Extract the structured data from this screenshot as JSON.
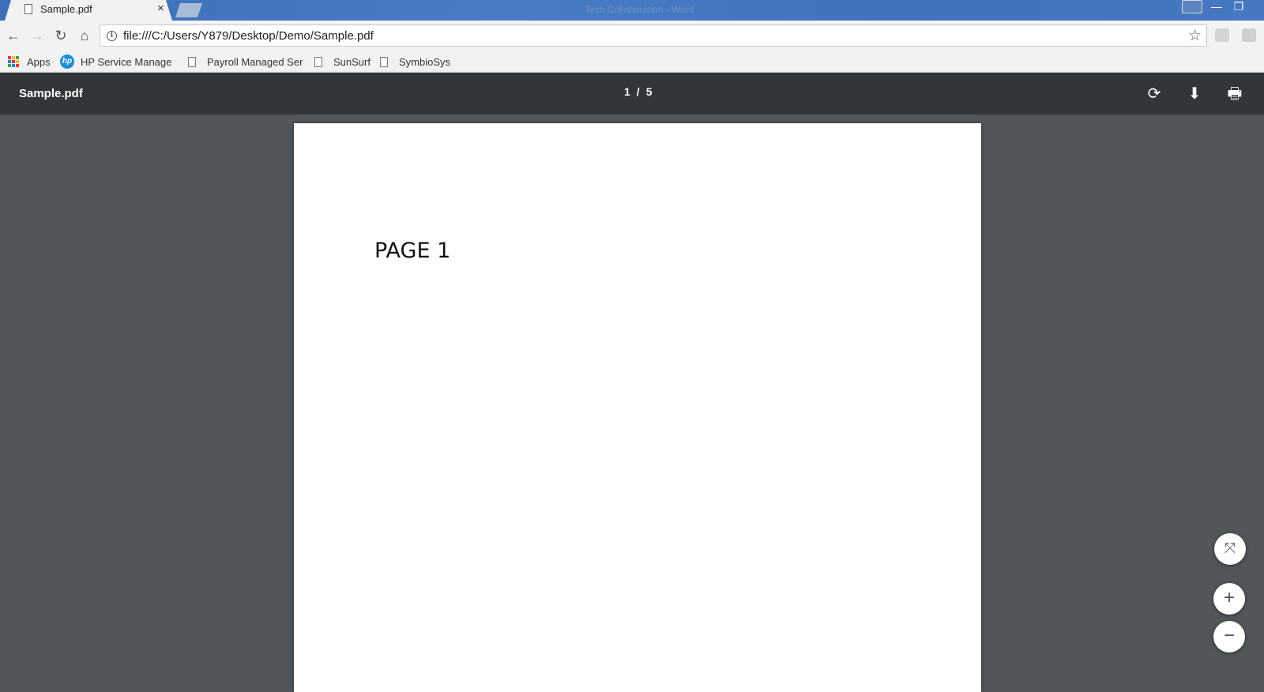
{
  "browser": {
    "tab": {
      "title": "Sample.pdf",
      "close_glyph": "×"
    },
    "window_title": "Tech Collaboration - Word",
    "window_controls": {
      "minimize_glyph": "—",
      "maximize_glyph": "❐"
    },
    "url": "file:///C:/Users/Y879/Desktop/Demo/Sample.pdf",
    "nav": {
      "back_glyph": "←",
      "forward_glyph": "→",
      "reload_glyph": "↻",
      "home_glyph": "⌂",
      "star_glyph": "☆"
    },
    "bookmarks": [
      {
        "label": "Apps",
        "icon": "apps-grid-icon"
      },
      {
        "label": "HP Service Manager:",
        "icon": "hp-logo-icon"
      },
      {
        "label": "Payroll Managed Ser",
        "icon": "page-icon"
      },
      {
        "label": "SunSurf",
        "icon": "page-icon"
      },
      {
        "label": "SymbioSys",
        "icon": "page-icon"
      }
    ],
    "apps_colors": [
      "#e53935",
      "#fbc02d",
      "#43a047",
      "#1e88e5",
      "#e53935",
      "#fbc02d",
      "#43a047",
      "#1e88e5",
      "#e53935"
    ]
  },
  "pdf_viewer": {
    "title": "Sample.pdf",
    "current_page": "1",
    "separator": "/",
    "total_pages": "5",
    "rotate_glyph": "⟳",
    "download_glyph": "⬇",
    "print_glyph": "🖶",
    "fit_glyph": "⤧",
    "zoom_in_glyph": "+",
    "zoom_out_glyph": "−"
  },
  "document": {
    "page1_text": "PAGE 1"
  },
  "colors": {
    "viewer_background": "#525659",
    "viewer_toolbar": "#323639",
    "titlebar": "#3d6fb6"
  }
}
